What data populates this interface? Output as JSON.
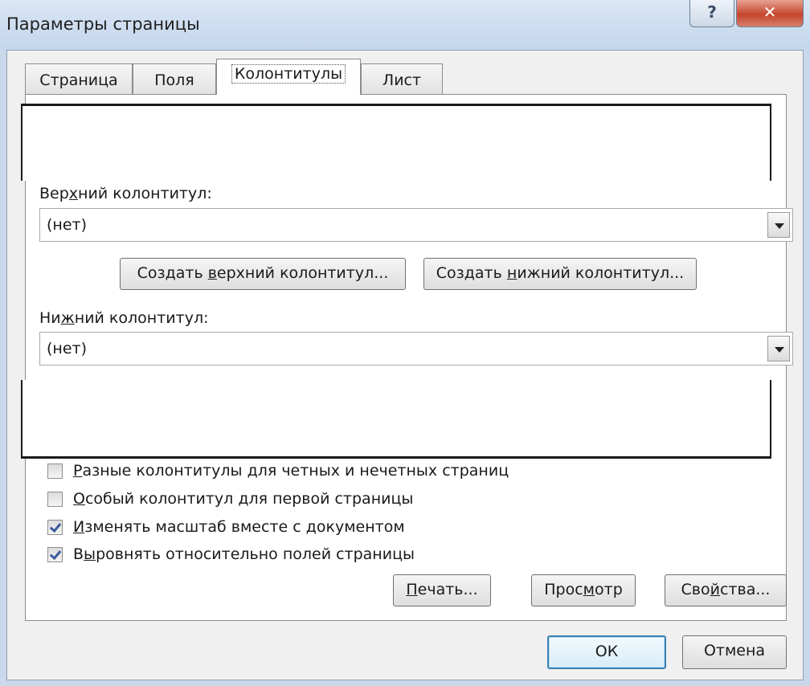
{
  "window": {
    "title": "Параметры страницы",
    "help_glyph": "?",
    "close_glyph": "✕"
  },
  "tabs": [
    {
      "label": "Страница",
      "active": false
    },
    {
      "label": "Поля",
      "active": false
    },
    {
      "label": "Колонтитулы",
      "active": true
    },
    {
      "label": "Лист",
      "active": false
    }
  ],
  "header": {
    "label_pre": "Вер",
    "label_ul": "х",
    "label_post": "ний колонтитул:",
    "value": "(нет)"
  },
  "footer": {
    "label_pre": "Ни",
    "label_ul": "ж",
    "label_post": "ний колонтитул:",
    "value": "(нет)"
  },
  "buttons": {
    "create_header": {
      "pre": "Создать ",
      "ul": "в",
      "post": "ерхний колонтитул..."
    },
    "create_footer": {
      "pre": "Создать ",
      "ul": "н",
      "post": "ижний колонтитул..."
    },
    "print": {
      "pre": "",
      "ul": "П",
      "post": "ечать..."
    },
    "preview": {
      "pre": "Прос",
      "ul": "м",
      "post": "отр"
    },
    "properties": {
      "pre": "Сво",
      "ul": "й",
      "post": "ства..."
    },
    "ok": "ОК",
    "cancel": "Отмена"
  },
  "checkboxes": [
    {
      "ul": "Р",
      "rest": "азные колонтитулы для четных и нечетных страниц",
      "checked": false
    },
    {
      "ul": "О",
      "rest": "собый колонтитул для первой страницы",
      "checked": false
    },
    {
      "ul": "И",
      "rest": "зменять масштаб вместе с документом",
      "checked": true
    },
    {
      "pre": "В",
      "ul": "ы",
      "rest": "ровнять относительно полей страницы",
      "checked": true
    }
  ],
  "colors": {
    "title_bar": "#c9d8ea",
    "close_button": "#c5462c",
    "dialog_face": "#f0f0f0",
    "ok_border": "#3c7fb1"
  }
}
